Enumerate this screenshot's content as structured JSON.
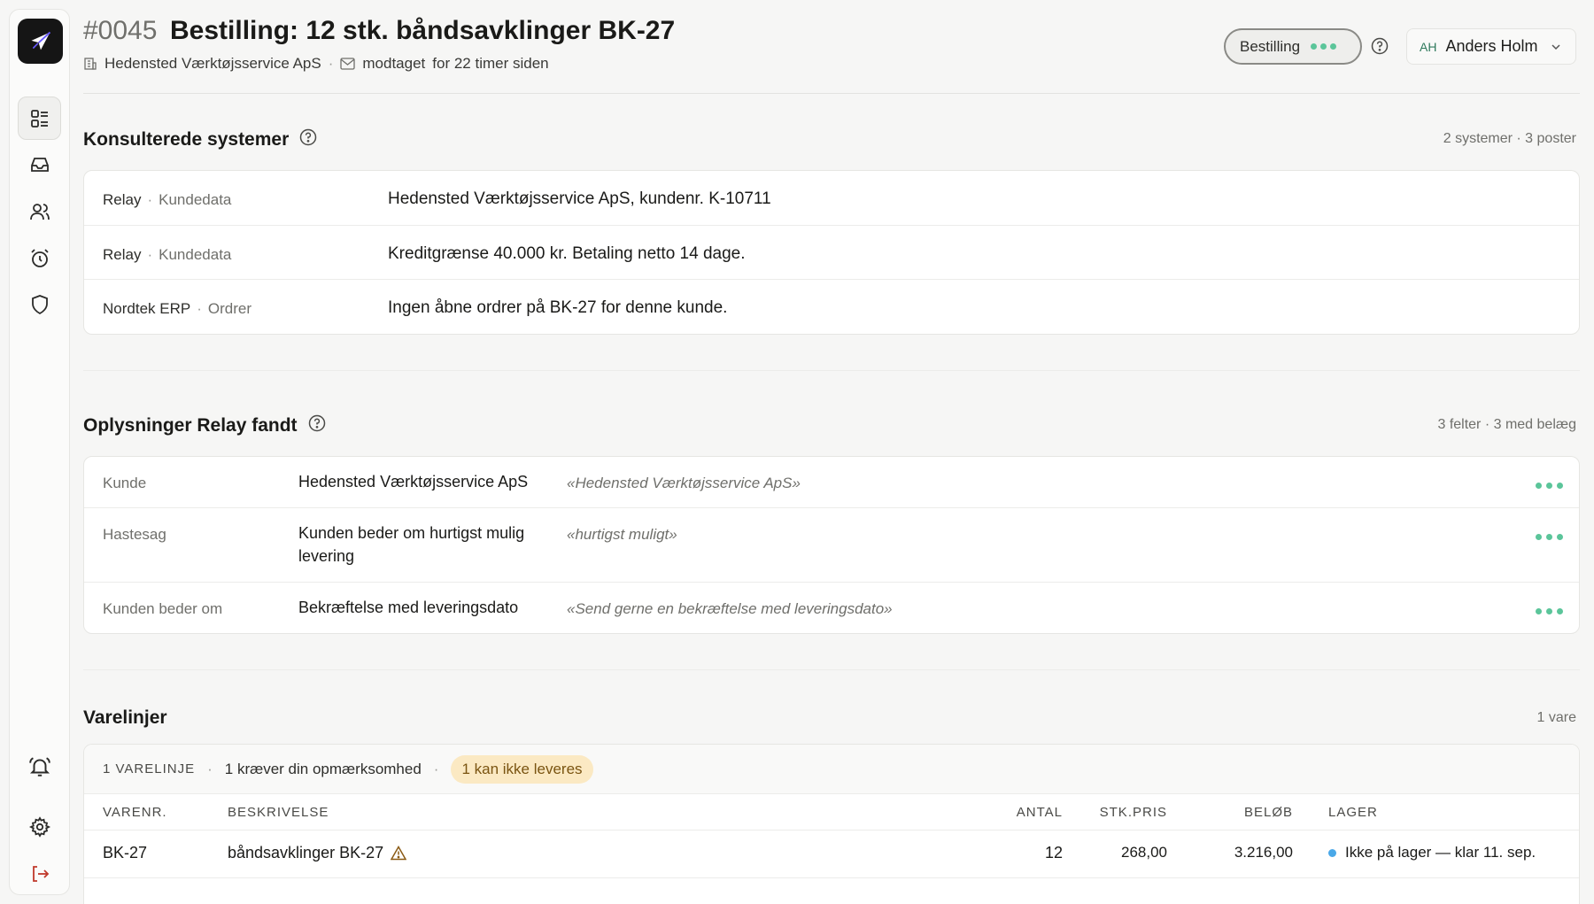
{
  "header": {
    "order_id": "#0045",
    "title": "Bestilling: 12 stk. båndsavklinger BK-27",
    "company": "Hedensted Værktøjsservice ApS",
    "received_label": "modtaget",
    "received_time": "for 22 timer siden",
    "mode_pill": "Bestilling",
    "user_initials": "AH",
    "user_name": "Anders Holm"
  },
  "systems": {
    "title": "Konsulterede systemer",
    "meta": "2 systemer · 3 poster",
    "rows": [
      {
        "system": "Relay",
        "category": "Kundedata",
        "value": "Hedensted Værktøjsservice ApS, kundenr. K-10711"
      },
      {
        "system": "Relay",
        "category": "Kundedata",
        "value": "Kreditgrænse 40.000 kr. Betaling netto 14 dage."
      },
      {
        "system": "Nordtek ERP",
        "category": "Ordrer",
        "value": "Ingen åbne ordrer på BK-27 for denne kunde."
      }
    ]
  },
  "findings": {
    "title": "Oplysninger Relay fandt",
    "meta": "3 felter · 3 med belæg",
    "rows": [
      {
        "label": "Kunde",
        "value_1": "Hedensted Værktøjsservice ApS",
        "value_2": "",
        "quote": "«Hedensted Værktøjsservice ApS»"
      },
      {
        "label": "Hastesag",
        "value_1": "Kunden beder om hurtigst mulig",
        "value_2": "levering",
        "quote": "«hurtigst muligt»"
      },
      {
        "label": "Kunden beder om",
        "value_1": "Bekræftelse med leveringsdato",
        "value_2": "",
        "quote": "«Send gerne en bekræftelse med leveringsdato»"
      }
    ]
  },
  "lines": {
    "title": "Varelinjer",
    "meta": "1 vare",
    "count_label": "1 VARELINJE",
    "attention_label": "1 kræver din opmærksomhed",
    "badge": "1 kan ikke leveres",
    "columns": {
      "item": "VARENR.",
      "desc": "BESKRIVELSE",
      "qty": "ANTAL",
      "price": "STK.PRIS",
      "amount": "BELØB",
      "stock": "LAGER"
    },
    "rows": [
      {
        "item": "BK-27",
        "desc": "båndsavklinger BK-27",
        "qty": "12",
        "price": "268,00",
        "amount": "3.216,00",
        "stock": "Ikke på lager — klar 11. sep."
      }
    ]
  },
  "colors": {
    "accent_green": "#5bc59a",
    "warning_bg": "#fbe9c3",
    "stock_blue": "#4aa8e8",
    "logout_red": "#c0392b"
  }
}
